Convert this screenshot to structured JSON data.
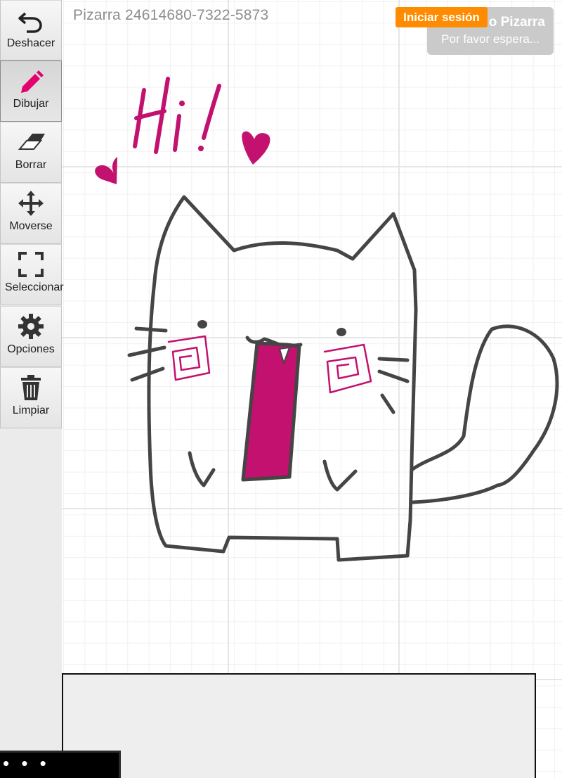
{
  "board": {
    "title": "Pizarra 24614680-7322-5873"
  },
  "drawing": {
    "text": "Hi!",
    "ink_color": "#c2116f",
    "stroke_color": "#454545"
  },
  "toolbar": {
    "tools": [
      {
        "label": "Deshacer",
        "icon": "undo-icon"
      },
      {
        "label": "Dibujar",
        "icon": "pencil-icon",
        "active": true
      },
      {
        "label": "Borrar",
        "icon": "eraser-icon"
      },
      {
        "label": "Moverse",
        "icon": "move-icon"
      },
      {
        "label": "Seleccionar",
        "icon": "select-icon"
      },
      {
        "label": "Opciones",
        "icon": "gear-icon"
      },
      {
        "label": "Limpiar",
        "icon": "trash-icon"
      }
    ]
  },
  "status": {
    "title": "o Pizarra",
    "subtitle": "Por favor espera..."
  },
  "login": {
    "label": "Iniciar sesión",
    "color": "#ff8c00"
  },
  "more": {
    "label": "• • •"
  }
}
